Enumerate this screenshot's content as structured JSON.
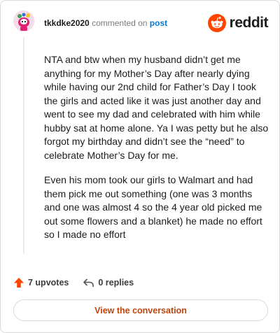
{
  "comment": {
    "username": "tkkdke2020",
    "action_text": "commented on",
    "post_link_text": "post",
    "paragraphs": [
      "NTA and btw when my husband didn’t get me anything for my Mother’s Day after nearly dying while having our 2nd child for Father’s Day I took the girls and acted like it was just another day and went to see my dad and celebrated with him while hubby sat at home alone. Ya I was petty but he also forgot my birthday and didn’t see the “need” to celebrate Mother’s Day for me.",
      "Even his mom took our girls to Walmart and had them pick me out something (one was 3 months and one was almost 4 so the 4 year old picked me out some flowers and a blanket) he made no effort so I made no effort"
    ]
  },
  "brand": {
    "name": "reddit",
    "color": "#ff4500"
  },
  "actions": {
    "upvotes_label": "7 upvotes",
    "replies_label": "0 replies",
    "upvote_icon": "upvote-arrow-icon",
    "reply_icon": "reply-arrow-icon"
  },
  "cta": {
    "view_conversation": "View the conversation",
    "color": "#c4450b"
  }
}
